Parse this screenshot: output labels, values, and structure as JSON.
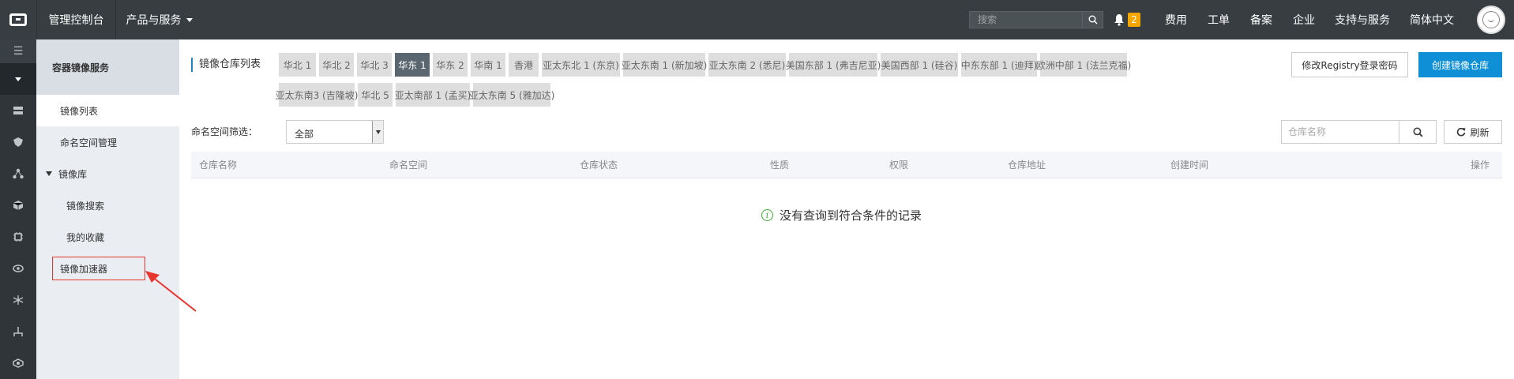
{
  "topbar": {
    "console": "管理控制台",
    "products": "产品与服务",
    "search_placeholder": "搜索",
    "notification_count": "2",
    "links": [
      "费用",
      "工单",
      "备案",
      "企业",
      "支持与服务",
      "简体中文"
    ]
  },
  "rail": {
    "toggle": "☰",
    "icons": [
      "server-icon",
      "shield-icon",
      "network-icon",
      "cube-icon",
      "chip-icon",
      "eye-icon",
      "cluster-icon",
      "flow-icon",
      "cloud-icon"
    ]
  },
  "sidebar": {
    "title": "容器镜像服务",
    "items": [
      {
        "label": "镜像列表"
      },
      {
        "label": "命名空间管理"
      },
      {
        "label": "镜像库"
      },
      {
        "label": "镜像搜索"
      },
      {
        "label": "我的收藏"
      },
      {
        "label": "镜像加速器"
      }
    ]
  },
  "main": {
    "title": "镜像仓库列表",
    "regions_row1": [
      "华北 1",
      "华北 2",
      "华北 3",
      "华东 1",
      "华东 2",
      "华南 1",
      "香港",
      "亚太东北 1 (东京)",
      "亚太东南 1 (新加坡)",
      "亚太东南 2 (悉尼)",
      "美国东部 1 (弗吉尼亚)",
      "美国西部 1 (硅谷)",
      "中东东部 1 (迪拜)",
      "欧洲中部 1 (法兰克福)"
    ],
    "regions_row2": [
      "亚太东南3 (吉隆坡)",
      "华北 5",
      "亚太南部 1 (孟买)",
      "亚太东南 5 (雅加达)"
    ],
    "active_region": "华东 1",
    "btn_modify": "修改Registry登录密码",
    "btn_create": "创建镜像仓库",
    "filter_label": "命名空间筛选：",
    "filter_value": "全部",
    "repo_search_placeholder": "仓库名称",
    "refresh": "刷新",
    "columns": [
      "仓库名称",
      "命名空间",
      "仓库状态",
      "性质",
      "权限",
      "仓库地址",
      "创建时间",
      "操作"
    ],
    "empty_message": "没有查询到符合条件的记录"
  },
  "colors": {
    "topbar": "#373d41",
    "primary": "#0e8fd6",
    "annotation": "#e8362f"
  }
}
